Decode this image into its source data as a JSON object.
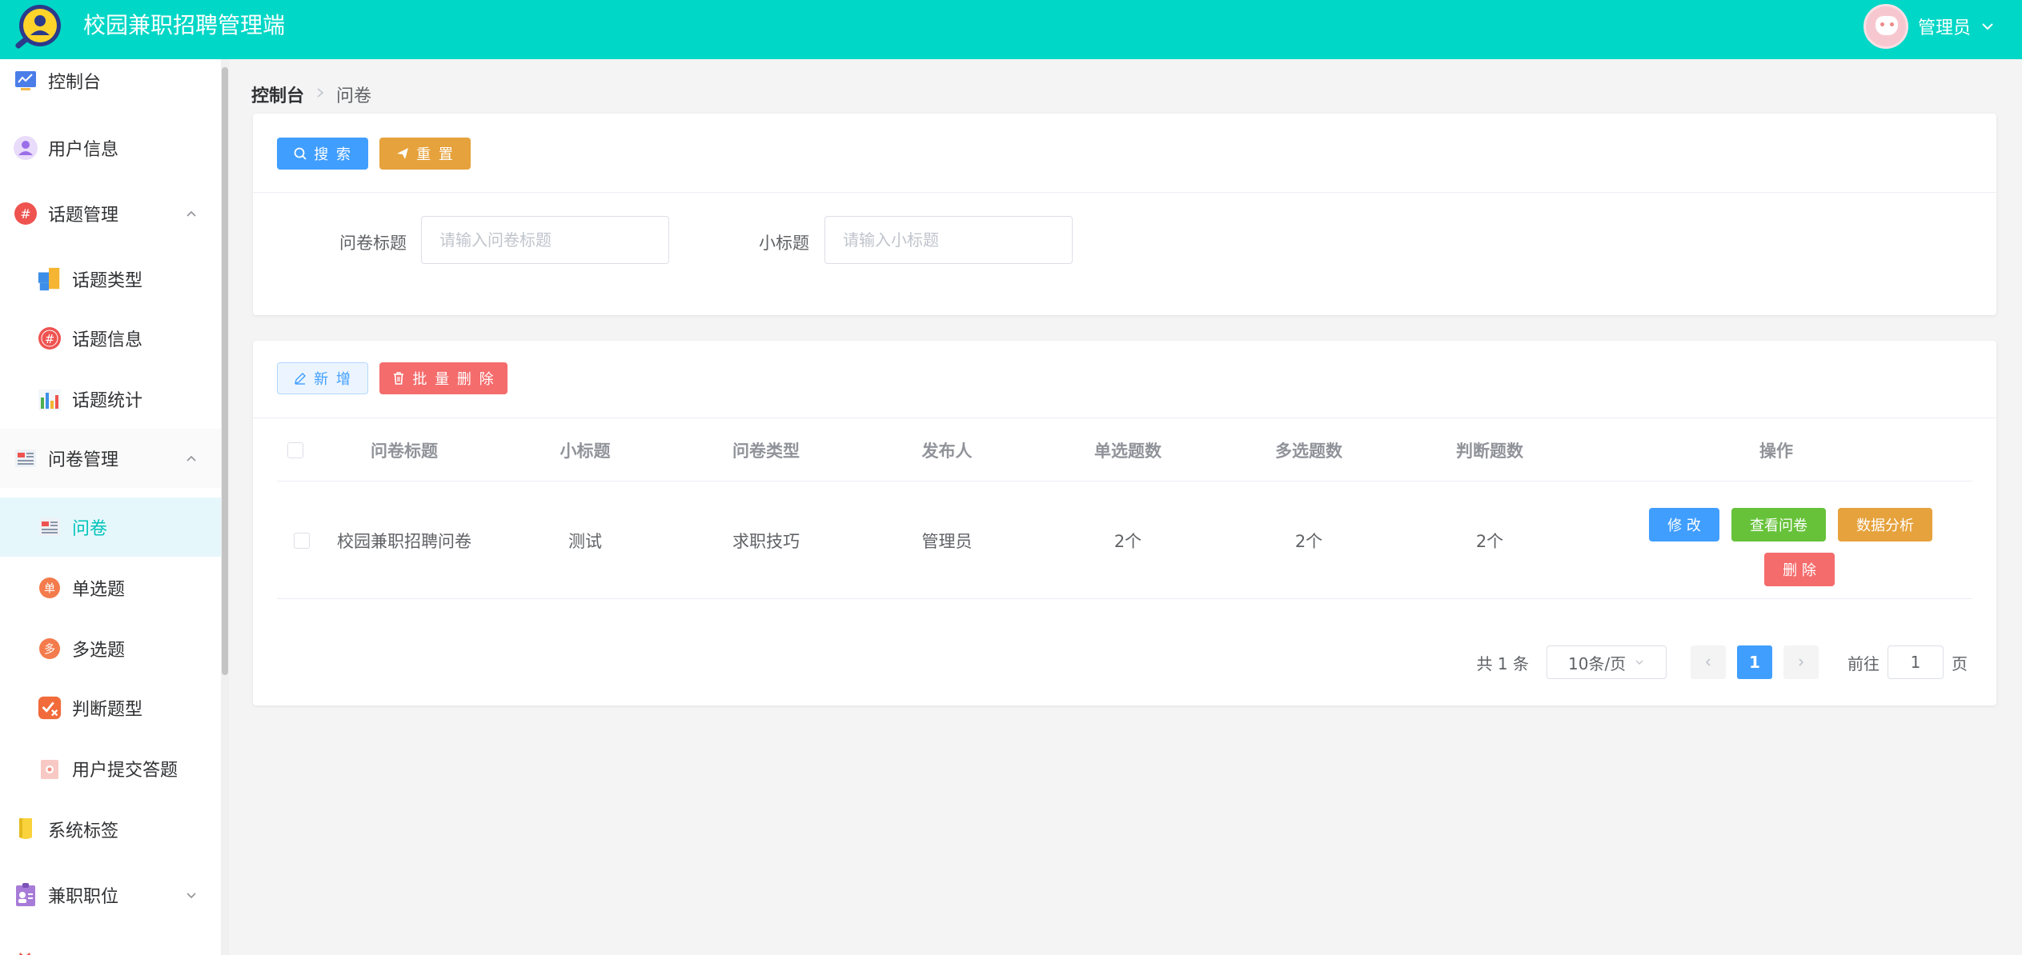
{
  "app": {
    "title": "校园兼职招聘管理端",
    "user_name": "管理员"
  },
  "sidebar": {
    "items": [
      {
        "label": "控制台",
        "icon": "dashboard-icon"
      },
      {
        "label": "用户信息",
        "icon": "user-icon"
      },
      {
        "label": "话题管理",
        "icon": "topic-icon",
        "expanded": true
      },
      {
        "label": "话题类型",
        "icon": "blocks-icon"
      },
      {
        "label": "话题信息",
        "icon": "hash-icon"
      },
      {
        "label": "话题统计",
        "icon": "chart-icon"
      },
      {
        "label": "问卷管理",
        "icon": "survey-icon",
        "expanded": true
      },
      {
        "label": "问卷",
        "icon": "survey-icon",
        "active": true
      },
      {
        "label": "单选题",
        "icon": "single-choice-icon",
        "badge": "单"
      },
      {
        "label": "多选题",
        "icon": "multi-choice-icon",
        "badge": "多"
      },
      {
        "label": "判断题型",
        "icon": "judge-icon"
      },
      {
        "label": "用户提交答题",
        "icon": "submission-icon"
      },
      {
        "label": "系统标签",
        "icon": "tag-icon"
      },
      {
        "label": "兼职职位",
        "icon": "job-icon",
        "expanded": false
      }
    ]
  },
  "breadcrumb": {
    "home": "控制台",
    "current": "问卷"
  },
  "search": {
    "search_label": "搜 索",
    "reset_label": "重 置",
    "title_label": "问卷标题",
    "title_placeholder": "请输入问卷标题",
    "subtitle_label": "小标题",
    "subtitle_placeholder": "请输入小标题"
  },
  "toolbar": {
    "add_label": "新 增",
    "batch_delete_label": "批 量 删 除"
  },
  "table": {
    "headers": [
      "问卷标题",
      "小标题",
      "问卷类型",
      "发布人",
      "单选题数",
      "多选题数",
      "判断题数",
      "操作"
    ],
    "rows": [
      {
        "title": "校园兼职招聘问卷",
        "subtitle": "测试",
        "type": "求职技巧",
        "publisher": "管理员",
        "single_count": "2个",
        "multi_count": "2个",
        "judge_count": "2个",
        "actions": {
          "edit": "修 改",
          "view": "查看问卷",
          "analyze": "数据分析",
          "delete": "删 除"
        }
      }
    ]
  },
  "pagination": {
    "total": "共 1 条",
    "page_size": "10条/页",
    "current_page": "1",
    "goto_label": "前往",
    "goto_value": "1",
    "page_suffix": "页"
  },
  "colors": {
    "header": "#00d7c6",
    "primary": "#409eff",
    "warning": "#e6a23c",
    "danger": "#f56c6c",
    "success": "#67c23a",
    "active_menu": "#00c3ba"
  }
}
